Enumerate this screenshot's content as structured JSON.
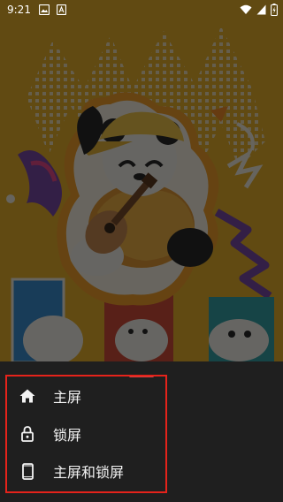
{
  "status_bar": {
    "time": "9:21",
    "left_icons": [
      "gallery-icon",
      "app-icon"
    ],
    "right_icons": [
      "wifi-icon",
      "signal-icon",
      "battery-icon"
    ]
  },
  "wallpaper": {
    "description_icon": "panda-guitar-wallpaper",
    "background_color": "#e9b52e"
  },
  "set_wallpaper_sheet": {
    "options": [
      {
        "label": "主屏",
        "icon": "home-icon"
      },
      {
        "label": "锁屏",
        "icon": "lock-icon"
      },
      {
        "label": "主屏和锁屏",
        "icon": "phone-icon"
      }
    ],
    "highlight_color": "#e5231b"
  }
}
